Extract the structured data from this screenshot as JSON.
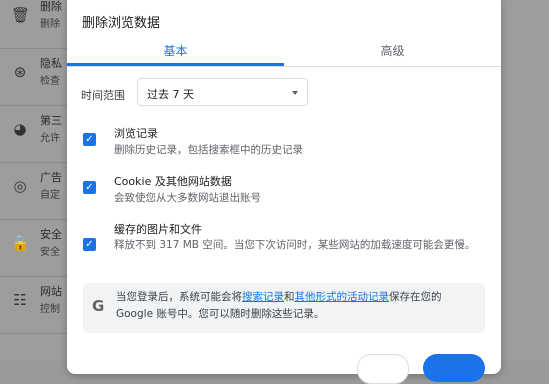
{
  "background": {
    "rows": [
      {
        "icon": "trash-icon",
        "glyph": "🗑",
        "title": "删除",
        "sub": "删除"
      },
      {
        "icon": "compass-icon",
        "glyph": "⊛",
        "title": "隐私",
        "sub": "检查"
      },
      {
        "icon": "cookie-icon",
        "glyph": "◕",
        "title": "第三",
        "sub": "允许"
      },
      {
        "icon": "ads-icon",
        "glyph": "◎",
        "title": "广告",
        "sub": "自定"
      },
      {
        "icon": "lock-icon",
        "glyph": "🔒",
        "title": "安全",
        "sub": "安全"
      },
      {
        "icon": "sliders-icon",
        "glyph": "☷",
        "title": "网站",
        "sub": "控制"
      }
    ]
  },
  "dialog": {
    "title": "删除浏览数据",
    "tabs": {
      "basic": "基本",
      "advanced": "高级"
    },
    "time_range": {
      "label": "时间范围",
      "value": "过去 7 天"
    },
    "items": [
      {
        "title": "浏览记录",
        "desc": "删除历史记录，包括搜索框中的历史记录",
        "checked": true
      },
      {
        "title": "Cookie 及其他网站数据",
        "desc": "会致使您从大多数网站退出账号",
        "checked": true
      },
      {
        "title": "缓存的图片和文件",
        "desc": "释放不到 317 MB 空间。当您下次访问时，某些网站的加载速度可能会更慢。",
        "checked": true
      }
    ],
    "info": {
      "logo": "G",
      "prefix": "当您登录后，系统可能会将",
      "link1": "搜索记录",
      "middle": "和",
      "link2": "其他形式的活动记录",
      "suffix": "保存在您的 Google 账号中。您可以随时删除这些记录。"
    },
    "colors": {
      "accent": "#1a73e8",
      "overlay": "#9d9d9d"
    }
  }
}
